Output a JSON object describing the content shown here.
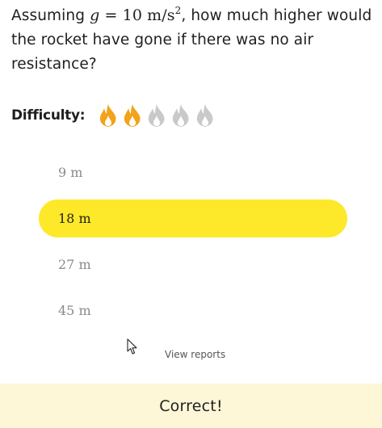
{
  "question": {
    "prefix": "Assuming ",
    "math_var": "g",
    "math_eq": " = 10 m/s",
    "math_sup": "2",
    "suffix": ", how much higher would the rocket have gone if there was no air resistance?"
  },
  "difficulty": {
    "label": "Difficulty:",
    "level": 2,
    "max_level": 5,
    "icon": "flame-icon",
    "active_color": "#f2a31b",
    "inactive_color": "#c9c9c9"
  },
  "answers": [
    {
      "label": "9 m",
      "selected": false
    },
    {
      "label": "18 m",
      "selected": true
    },
    {
      "label": "27 m",
      "selected": false
    },
    {
      "label": "45 m",
      "selected": false
    }
  ],
  "colors": {
    "selected_answer_bg": "#fde82a",
    "result_bar_bg": "#fdf7d8"
  },
  "view_reports_label": "View reports",
  "result_text": "Correct!"
}
